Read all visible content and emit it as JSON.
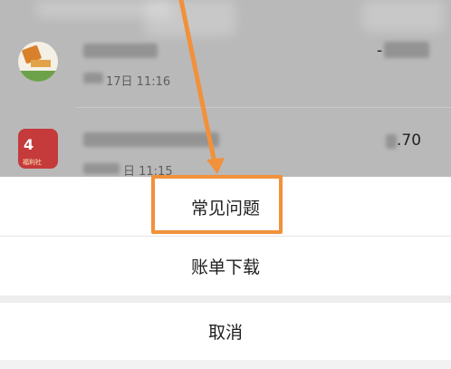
{
  "background_list": {
    "items": [
      {
        "time": "17日 11:16",
        "amount": "-"
      },
      {
        "time": "日 11:15",
        "amount": ".70",
        "avatar_text": "4",
        "avatar_tag": "福利社"
      }
    ]
  },
  "action_sheet": {
    "options": [
      {
        "label": "常见问题"
      },
      {
        "label": "账单下载"
      }
    ],
    "cancel_label": "取消"
  },
  "annotation": {
    "highlight_color": "#f1913b"
  }
}
